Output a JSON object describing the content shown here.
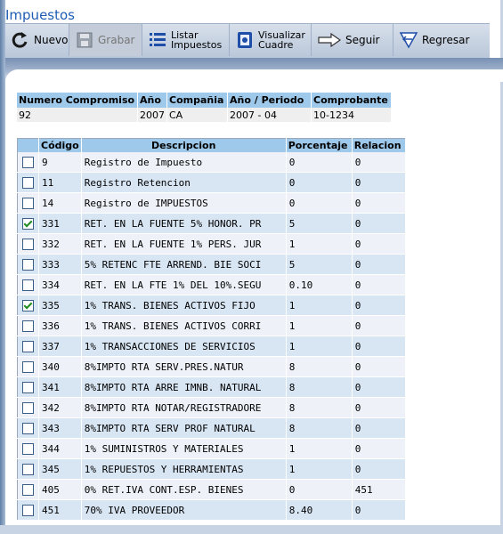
{
  "window": {
    "title": "Impuestos"
  },
  "toolbar": {
    "nuevo": "Nuevo",
    "grabar": "Grabar",
    "listar_l1": "Listar",
    "listar_l2": "Impuestos",
    "visualizar_l1": "Visualizar",
    "visualizar_l2": "Cuadre",
    "seguir": "Seguir",
    "regresar": "Regresar"
  },
  "header_table": {
    "columns": [
      "Numero Compromiso",
      "Año",
      "Compañia",
      "Año / Periodo",
      "Comprobante"
    ],
    "row": [
      "92",
      "2007",
      "CA",
      "2007 - 04",
      "10-1234"
    ]
  },
  "tax_table": {
    "columns": [
      "",
      "Código",
      "Descripcion",
      "Porcentaje",
      "Relacion"
    ],
    "rows": [
      {
        "checked": false,
        "codigo": "9",
        "descripcion": "Registro de Impuesto",
        "porcentaje": "0",
        "relacion": "0"
      },
      {
        "checked": false,
        "codigo": "11",
        "descripcion": "Registro Retencion",
        "porcentaje": "0",
        "relacion": "0"
      },
      {
        "checked": false,
        "codigo": "14",
        "descripcion": "Registro de IMPUESTOS",
        "porcentaje": "0",
        "relacion": "0"
      },
      {
        "checked": true,
        "codigo": "331",
        "descripcion": "RET. EN LA FUENTE 5% HONOR. PR",
        "porcentaje": "5",
        "relacion": "0"
      },
      {
        "checked": false,
        "codigo": "332",
        "descripcion": "RET. EN LA FUENTE 1% PERS. JUR",
        "porcentaje": "1",
        "relacion": "0"
      },
      {
        "checked": false,
        "codigo": "333",
        "descripcion": "5% RETENC FTE ARREND. BIE SOCI",
        "porcentaje": "5",
        "relacion": "0"
      },
      {
        "checked": false,
        "codigo": "334",
        "descripcion": "RET. EN LA FTE 1% DEL 10%.SEGU",
        "porcentaje": "0.10",
        "relacion": "0"
      },
      {
        "checked": true,
        "codigo": "335",
        "descripcion": "1% TRANS. BIENES ACTIVOS FIJO",
        "porcentaje": "1",
        "relacion": "0"
      },
      {
        "checked": false,
        "codigo": "336",
        "descripcion": "1% TRANS. BIENES ACTIVOS CORRI",
        "porcentaje": "1",
        "relacion": "0"
      },
      {
        "checked": false,
        "codigo": "337",
        "descripcion": "1% TRANSACCIONES DE SERVICIOS",
        "porcentaje": "1",
        "relacion": "0"
      },
      {
        "checked": false,
        "codigo": "340",
        "descripcion": "8%IMPTO RTA SERV.PRES.NATUR",
        "porcentaje": "8",
        "relacion": "0"
      },
      {
        "checked": false,
        "codigo": "341",
        "descripcion": "8%IMPTO RTA ARRE IMNB. NATURAL",
        "porcentaje": "8",
        "relacion": "0"
      },
      {
        "checked": false,
        "codigo": "342",
        "descripcion": "8%IMPTO RTA NOTAR/REGISTRADORE",
        "porcentaje": "8",
        "relacion": "0"
      },
      {
        "checked": false,
        "codigo": "343",
        "descripcion": "8%IMPTO RTA SERV PROF NATURAL",
        "porcentaje": "8",
        "relacion": "0"
      },
      {
        "checked": false,
        "codigo": "344",
        "descripcion": "1% SUMINISTROS Y MATERIALES",
        "porcentaje": "1",
        "relacion": "0"
      },
      {
        "checked": false,
        "codigo": "345",
        "descripcion": "1% REPUESTOS Y HERRAMIENTAS",
        "porcentaje": "1",
        "relacion": "0"
      },
      {
        "checked": false,
        "codigo": "405",
        "descripcion": "0% RET.IVA CONT.ESP. BIENES",
        "porcentaje": "0",
        "relacion": "451"
      },
      {
        "checked": false,
        "codigo": "451",
        "descripcion": "70% IVA PROVEEDOR",
        "porcentaje": "8.40",
        "relacion": "0"
      }
    ]
  }
}
